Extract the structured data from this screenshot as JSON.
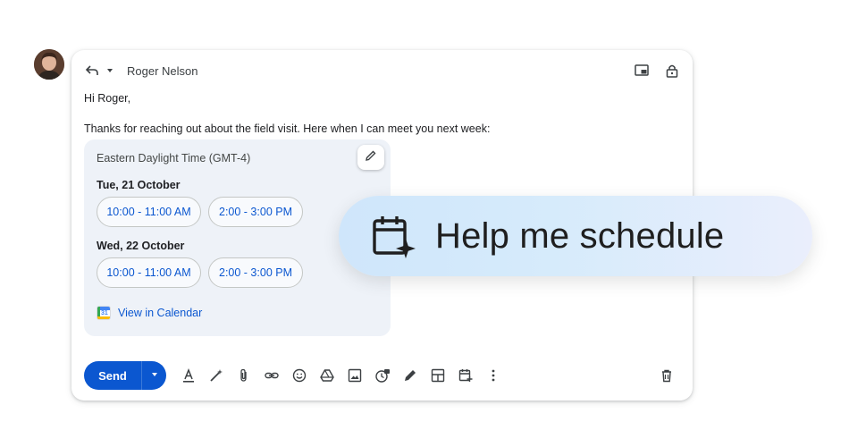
{
  "reply": {
    "recipient": "Roger Nelson"
  },
  "email": {
    "greeting": "Hi Roger,",
    "body": "Thanks for reaching out about the field visit. Here when I can meet you next week:"
  },
  "schedule": {
    "timezone": "Eastern Daylight Time (GMT-4)",
    "days": [
      {
        "label": "Tue, 21 October",
        "slots": [
          "10:00 - 11:00 AM",
          "2:00 - 3:00 PM"
        ]
      },
      {
        "label": "Wed, 22 October",
        "slots": [
          "10:00 - 11:00 AM",
          "2:00 - 3:00 PM"
        ]
      }
    ],
    "view_calendar": "View in Calendar",
    "calendar_icon_number": "31"
  },
  "toolbar": {
    "send_label": "Send"
  },
  "feature": {
    "label": "Help me schedule"
  },
  "colors": {
    "accent": "#0b57d0",
    "panel": "#eef2f8"
  },
  "icons": {
    "reply": "reply-icon",
    "dropdown": "chevron-down-icon",
    "popout": "popout-icon",
    "lock": "lock-icon",
    "edit": "pencil-icon",
    "format": "text-format-icon",
    "magic": "magic-wand-icon",
    "attach": "paperclip-icon",
    "link": "link-icon",
    "emoji": "emoji-icon",
    "drive": "drive-icon",
    "photo": "photo-icon",
    "confidential": "confidential-icon",
    "signature": "signature-pen-icon",
    "layout": "layout-icon",
    "schedule": "calendar-schedule-icon",
    "more": "more-vert-icon",
    "trash": "trash-icon"
  }
}
